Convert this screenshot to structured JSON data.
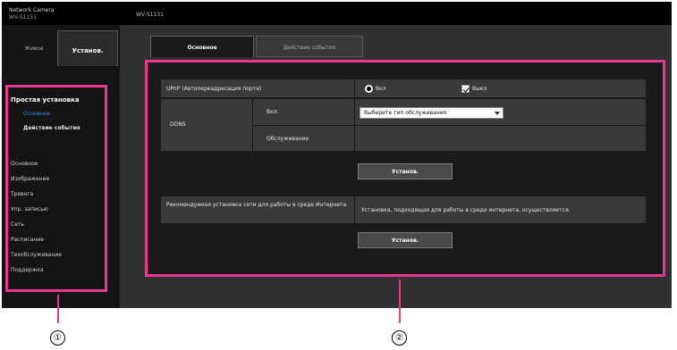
{
  "header": {
    "brand_line1": "Network Camera",
    "brand_line2": "WV-S1131",
    "model": "WV-S1131"
  },
  "top_tabs": {
    "live": "Живое",
    "setup": "Установ."
  },
  "menu": {
    "section": "Простая установка",
    "basic": "Основное",
    "action_event": "Действие события",
    "items": [
      "Основное",
      "Изображение",
      "Тревога",
      "Упр. записью",
      "Сеть",
      "Расписание",
      "Техобслуживание",
      "Поддержка"
    ]
  },
  "content_tabs": {
    "basic": "Основное",
    "action": "Действие события"
  },
  "form": {
    "upnp_label": "UPnP (Автопереадресация порта)",
    "radio_on": "Вкл",
    "radio_off": "Выкл",
    "ddns_label": "DDNS",
    "service_label": "Вкл.",
    "service_value": "Выберите тип обслуживания",
    "maintenance_label": "Обслуживание",
    "set_button": "Установ.",
    "recommend_label": "Рекомендуемая установка сети для работы в среде Интернета",
    "recommend_value": "Установка, подходящая для работы в среде интернета, осуществляется.",
    "set_button2": "Установ."
  },
  "callouts": {
    "c1": "①",
    "c2": "②"
  },
  "colors": {
    "accent": "#e8388f",
    "active_link": "#2a8fd4"
  }
}
